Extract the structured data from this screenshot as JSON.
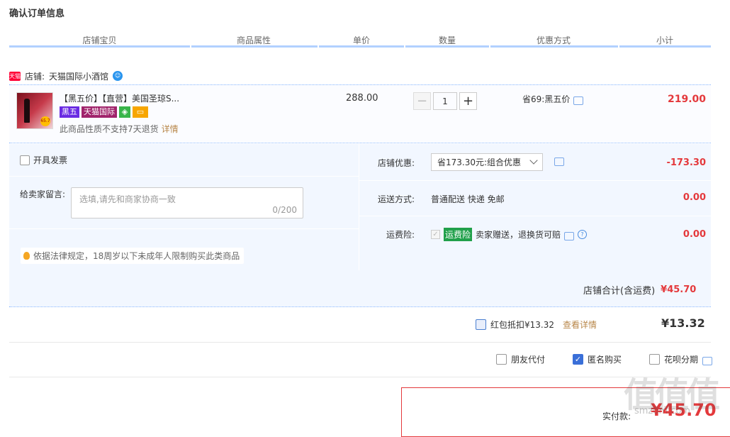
{
  "page_title": "确认订单信息",
  "columns": [
    "店铺宝贝",
    "商品属性",
    "单价",
    "数量",
    "优惠方式",
    "小计"
  ],
  "shop": {
    "badge": "天猫",
    "prefix": "店铺:",
    "name": "天猫国际小酒馆"
  },
  "item": {
    "title": "【黑五价】【直营】美国圣琼S...",
    "tags": {
      "black_five": "黑五",
      "tmall_intl": "天猫国际"
    },
    "thumb_badge": "65.7",
    "note": "此商品性质不支持7天退货",
    "note_link": "详情",
    "price": "288.00",
    "quantity": "1",
    "qty_minus": "−",
    "qty_plus": "+",
    "discount": "省69:黑五价",
    "subtotal": "219.00"
  },
  "options": {
    "invoice_label": "开具发票",
    "message_label": "给卖家留言:",
    "message_placeholder": "选填,请先和商家协商一致",
    "message_count": "0/200",
    "law_notice": "依据法律规定，18周岁以下未成年人限制购买此类商品",
    "shop_discount_label": "店铺优惠:",
    "shop_discount_value": "省173.30元:组合优惠",
    "shop_discount_amount": "-173.30",
    "shipping_label": "运送方式:",
    "shipping_value": "普通配送 快递 免邮",
    "shipping_amount": "0.00",
    "insurance_label": "运费险:",
    "insurance_badge": "运费险",
    "insurance_text": "卖家赠送，退换货可赔",
    "insurance_amount": "0.00"
  },
  "shop_total": {
    "label": "店铺合计(含运费)",
    "amount": "¥45.70"
  },
  "redpack": {
    "label": "红包抵扣¥13.32",
    "link": "查看详情",
    "amount": "¥13.32"
  },
  "pay_options": {
    "friend": "朋友代付",
    "anonymous": "匿名购买",
    "huabei": "花呗分期"
  },
  "final": {
    "label": "实付款:",
    "amount": "¥45.70"
  },
  "watermark": {
    "logo": "值值值",
    "site": "smzdm.com"
  }
}
